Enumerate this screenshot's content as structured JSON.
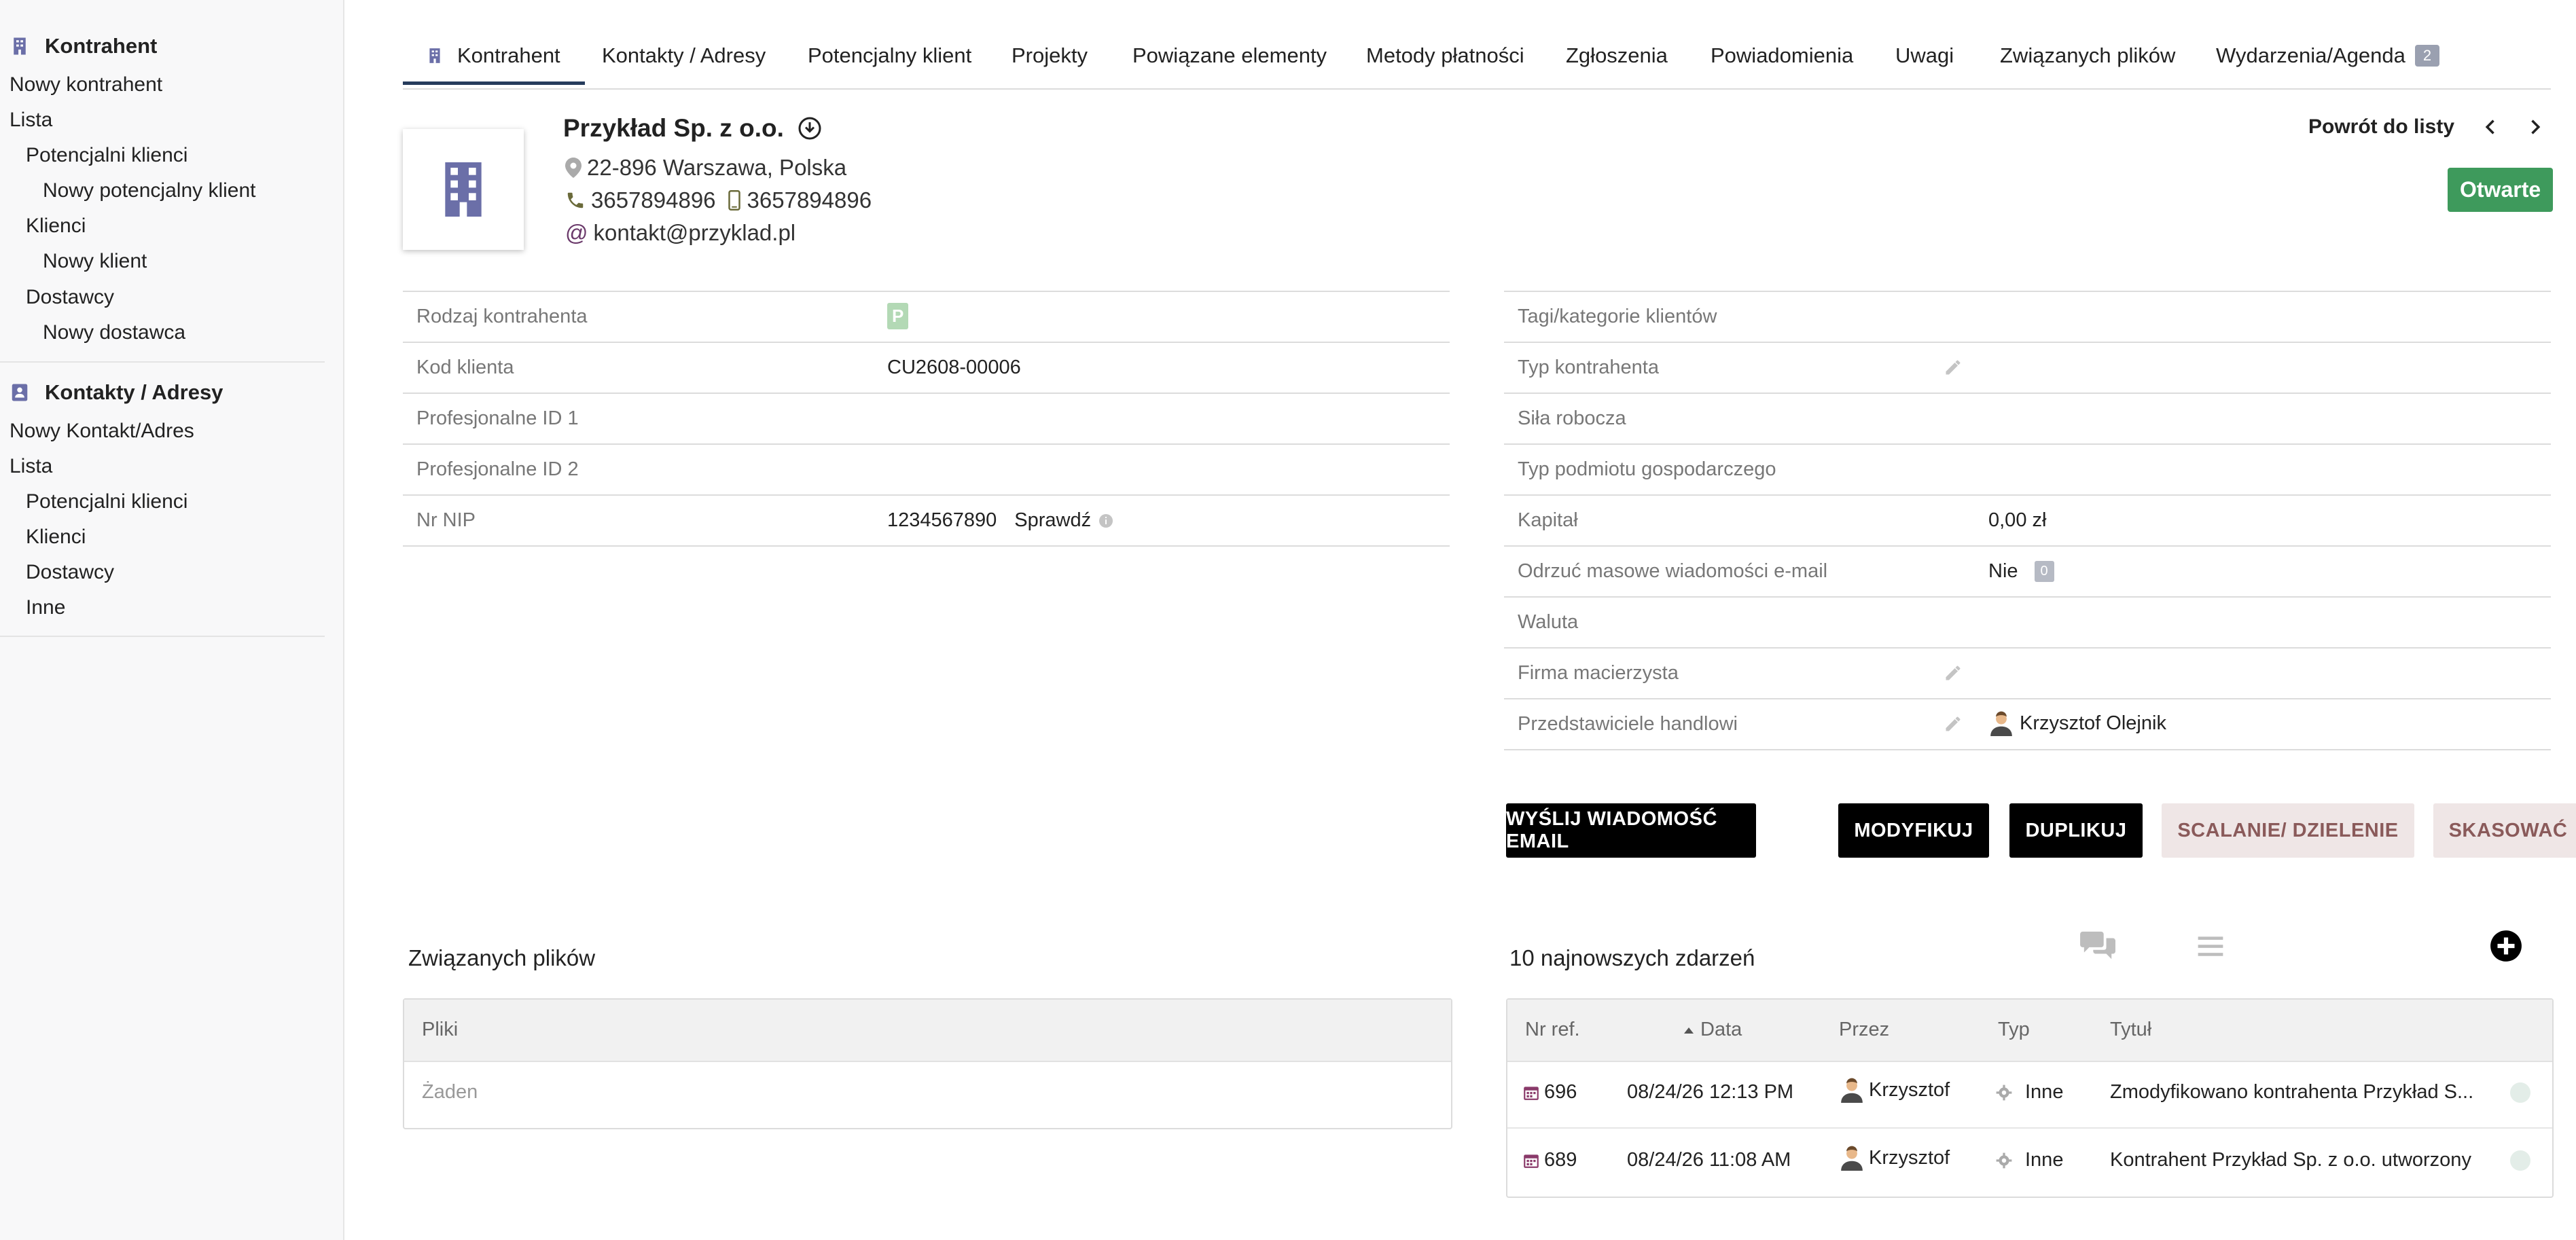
{
  "sidebar": {
    "section1_title": "Kontrahent",
    "new_thirdparty": "Nowy kontrahent",
    "list": "Lista",
    "prospects": "Potencjalni klienci",
    "new_prospect": "Nowy potencjalny klient",
    "customers": "Klienci",
    "new_customer": "Nowy klient",
    "suppliers": "Dostawcy",
    "new_supplier": "Nowy dostawca",
    "section2_title": "Kontakty / Adresy",
    "new_contact": "Nowy Kontakt/Adres",
    "list2": "Lista",
    "prospects2": "Potencjalni klienci",
    "customers2": "Klienci",
    "suppliers2": "Dostawcy",
    "others": "Inne"
  },
  "tabs": [
    {
      "label": "Kontrahent"
    },
    {
      "label": "Kontakty / Adresy"
    },
    {
      "label": "Potencjalny klient"
    },
    {
      "label": "Projekty"
    },
    {
      "label": "Powiązane elementy"
    },
    {
      "label": "Metody płatności"
    },
    {
      "label": "Zgłoszenia"
    },
    {
      "label": "Powiadomienia"
    },
    {
      "label": "Uwagi"
    },
    {
      "label": "Związanych plików"
    },
    {
      "label": "Wydarzenia/Agenda",
      "badge": "2"
    }
  ],
  "header": {
    "company_name": "Przykład Sp. z o.o.",
    "address": "22-896 Warszawa, Polska",
    "phone": "3657894896",
    "mobile": "3657894896",
    "email": "kontakt@przyklad.pl",
    "back_label": "Powrót do listy",
    "status": "Otwarte"
  },
  "left_fields": {
    "thirdparty_type_label": "Rodzaj kontrahenta",
    "thirdparty_type_badge": "P",
    "customer_code_label": "Kod klienta",
    "customer_code": "CU2608-00006",
    "prof_id1_label": "Profesjonalne ID 1",
    "prof_id2_label": "Profesjonalne ID 2",
    "nip_label": "Nr NIP",
    "nip": "1234567890",
    "check_label": "Sprawdź"
  },
  "right_fields": {
    "tags_label": "Tagi/kategorie klientów",
    "type_label": "Typ kontrahenta",
    "workforce_label": "Siła robocza",
    "entity_label": "Typ podmiotu gospodarczego",
    "capital_label": "Kapitał",
    "capital": "0,00 zł",
    "mass_email_label": "Odrzuć masowe wiadomości e-mail",
    "mass_email": "Nie",
    "mass_email_count": "0",
    "currency_label": "Waluta",
    "parent_label": "Firma macierzysta",
    "sales_rep_label": "Przedstawiciele handlowi",
    "sales_rep": "Krzysztof Olejnik"
  },
  "buttons": {
    "send_email": "WYŚLIJ WIADOMOŚĆ EMAIL",
    "modify": "MODYFIKUJ",
    "duplicate": "DUPLIKUJ",
    "merge": "SCALANIE/ DZIELENIE",
    "delete": "SKASOWAĆ"
  },
  "files": {
    "title": "Związanych plików",
    "header": "Pliki",
    "empty": "Żaden"
  },
  "events": {
    "title": "10 najnowszych zdarzeń",
    "col_ref": "Nr ref.",
    "col_date": "Data",
    "col_by": "Przez",
    "col_type": "Typ",
    "col_title": "Tytuł",
    "rows": [
      {
        "ref": "696",
        "date": "08/24/26 12:13 PM",
        "by": "Krzysztof",
        "type": "Inne",
        "title": "Zmodyfikowano kontrahenta Przykład S..."
      },
      {
        "ref": "689",
        "date": "08/24/26 11:08 AM",
        "by": "Krzysztof",
        "type": "Inne",
        "title": "Kontrahent Przykład Sp. z o.o. utworzony"
      }
    ]
  },
  "colors": {
    "accent": "#263c5c",
    "icon_purple": "#6b6fa8",
    "status_green": "#3e9a5c",
    "dark_button": "#000000",
    "light_button": "#efe6e6"
  }
}
